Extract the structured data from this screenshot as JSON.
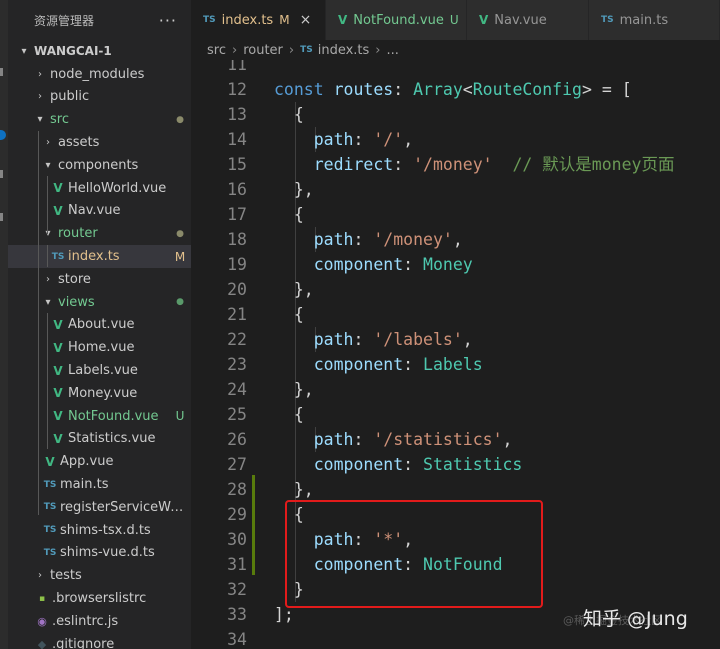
{
  "explorer": {
    "title": "资源管理器",
    "more": "···",
    "project": "WANGCAI-1",
    "items": [
      {
        "label": "node_modules",
        "kind": "folder",
        "open": false
      },
      {
        "label": "public",
        "kind": "folder",
        "open": false
      },
      {
        "label": "src",
        "kind": "folder",
        "open": true
      },
      {
        "label": "assets",
        "kind": "folder",
        "open": false
      },
      {
        "label": "components",
        "kind": "folder",
        "open": true
      },
      {
        "label": "HelloWorld.vue",
        "kind": "vue"
      },
      {
        "label": "Nav.vue",
        "kind": "vue"
      },
      {
        "label": "router",
        "kind": "folder",
        "open": true
      },
      {
        "label": "index.ts",
        "kind": "ts",
        "badge": "M"
      },
      {
        "label": "store",
        "kind": "folder",
        "open": false
      },
      {
        "label": "views",
        "kind": "folder",
        "open": true
      },
      {
        "label": "About.vue",
        "kind": "vue"
      },
      {
        "label": "Home.vue",
        "kind": "vue"
      },
      {
        "label": "Labels.vue",
        "kind": "vue"
      },
      {
        "label": "Money.vue",
        "kind": "vue"
      },
      {
        "label": "NotFound.vue",
        "kind": "vue",
        "badge": "U"
      },
      {
        "label": "Statistics.vue",
        "kind": "vue"
      },
      {
        "label": "App.vue",
        "kind": "vue"
      },
      {
        "label": "main.ts",
        "kind": "ts"
      },
      {
        "label": "registerServiceWork...",
        "kind": "ts"
      },
      {
        "label": "shims-tsx.d.ts",
        "kind": "ts"
      },
      {
        "label": "shims-vue.d.ts",
        "kind": "ts"
      },
      {
        "label": "tests",
        "kind": "folder",
        "open": false
      },
      {
        "label": ".browserslistrc",
        "kind": "file"
      },
      {
        "label": ".eslintrc.js",
        "kind": "eslint"
      },
      {
        "label": ".gitignore",
        "kind": "git"
      }
    ]
  },
  "tabs": [
    {
      "label": "index.ts",
      "icon": "TS",
      "badge": "M",
      "close": "×",
      "active": true
    },
    {
      "label": "NotFound.vue",
      "icon": "V",
      "badge": "U",
      "active": false
    },
    {
      "label": "Nav.vue",
      "icon": "V",
      "active": false
    },
    {
      "label": "main.ts",
      "icon": "TS",
      "active": false
    }
  ],
  "breadcrumb": [
    "src",
    "router",
    "index.ts",
    "..."
  ],
  "editor": {
    "lines": [
      {
        "n": "11",
        "tokens": []
      },
      {
        "n": "12",
        "tokens": [
          [
            "kw",
            "const "
          ],
          [
            "var",
            "routes"
          ],
          [
            "pn",
            ": "
          ],
          [
            "ty",
            "Array"
          ],
          [
            "pn",
            "<"
          ],
          [
            "ty",
            "RouteConfig"
          ],
          [
            "pn",
            "> = ["
          ]
        ]
      },
      {
        "n": "13",
        "tokens": [
          [
            "pn",
            "  {"
          ]
        ]
      },
      {
        "n": "14",
        "tokens": [
          [
            "pn",
            "    "
          ],
          [
            "var",
            "path"
          ],
          [
            "pn",
            ": "
          ],
          [
            "str",
            "'/'"
          ],
          [
            "pn",
            ","
          ]
        ]
      },
      {
        "n": "15",
        "tokens": [
          [
            "pn",
            "    "
          ],
          [
            "var",
            "redirect"
          ],
          [
            "pn",
            ": "
          ],
          [
            "str",
            "'/money'"
          ],
          [
            "pn",
            "  "
          ],
          [
            "cm",
            "// 默认是money页面"
          ]
        ]
      },
      {
        "n": "16",
        "tokens": [
          [
            "pn",
            "  },"
          ]
        ]
      },
      {
        "n": "17",
        "tokens": [
          [
            "pn",
            "  {"
          ]
        ]
      },
      {
        "n": "18",
        "tokens": [
          [
            "pn",
            "    "
          ],
          [
            "var",
            "path"
          ],
          [
            "pn",
            ": "
          ],
          [
            "str",
            "'/money'"
          ],
          [
            "pn",
            ","
          ]
        ]
      },
      {
        "n": "19",
        "tokens": [
          [
            "pn",
            "    "
          ],
          [
            "var",
            "component"
          ],
          [
            "pn",
            ": "
          ],
          [
            "ty",
            "Money"
          ]
        ]
      },
      {
        "n": "20",
        "tokens": [
          [
            "pn",
            "  },"
          ]
        ]
      },
      {
        "n": "21",
        "tokens": [
          [
            "pn",
            "  {"
          ]
        ]
      },
      {
        "n": "22",
        "tokens": [
          [
            "pn",
            "    "
          ],
          [
            "var",
            "path"
          ],
          [
            "pn",
            ": "
          ],
          [
            "str",
            "'/labels'"
          ],
          [
            "pn",
            ","
          ]
        ]
      },
      {
        "n": "23",
        "tokens": [
          [
            "pn",
            "    "
          ],
          [
            "var",
            "component"
          ],
          [
            "pn",
            ": "
          ],
          [
            "ty",
            "Labels"
          ]
        ]
      },
      {
        "n": "24",
        "tokens": [
          [
            "pn",
            "  },"
          ]
        ]
      },
      {
        "n": "25",
        "tokens": [
          [
            "pn",
            "  {"
          ]
        ]
      },
      {
        "n": "26",
        "tokens": [
          [
            "pn",
            "    "
          ],
          [
            "var",
            "path"
          ],
          [
            "pn",
            ": "
          ],
          [
            "str",
            "'/statistics'"
          ],
          [
            "pn",
            ","
          ]
        ]
      },
      {
        "n": "27",
        "tokens": [
          [
            "pn",
            "    "
          ],
          [
            "var",
            "component"
          ],
          [
            "pn",
            ": "
          ],
          [
            "ty",
            "Statistics"
          ]
        ]
      },
      {
        "n": "28",
        "tokens": [
          [
            "pn",
            "  },"
          ]
        ]
      },
      {
        "n": "29",
        "tokens": [
          [
            "pn",
            "  {"
          ]
        ]
      },
      {
        "n": "30",
        "tokens": [
          [
            "pn",
            "    "
          ],
          [
            "var",
            "path"
          ],
          [
            "pn",
            ": "
          ],
          [
            "str",
            "'*'"
          ],
          [
            "pn",
            ","
          ]
        ]
      },
      {
        "n": "31",
        "tokens": [
          [
            "pn",
            "    "
          ],
          [
            "var",
            "component"
          ],
          [
            "pn",
            ": "
          ],
          [
            "ty",
            "NotFound"
          ]
        ]
      },
      {
        "n": "32",
        "tokens": [
          [
            "pn",
            "  }"
          ]
        ]
      },
      {
        "n": "33",
        "tokens": [
          [
            "pn",
            "];"
          ]
        ]
      },
      {
        "n": "34",
        "tokens": []
      }
    ]
  },
  "watermark": {
    "text": "知乎 @Jung",
    "sub": "@稀土掘金技术社区"
  },
  "colors": {
    "accent": "#0e70c0",
    "highlight_box": "#e21b1b",
    "git_modified": "#e2c08d",
    "git_untracked": "#73c991"
  }
}
